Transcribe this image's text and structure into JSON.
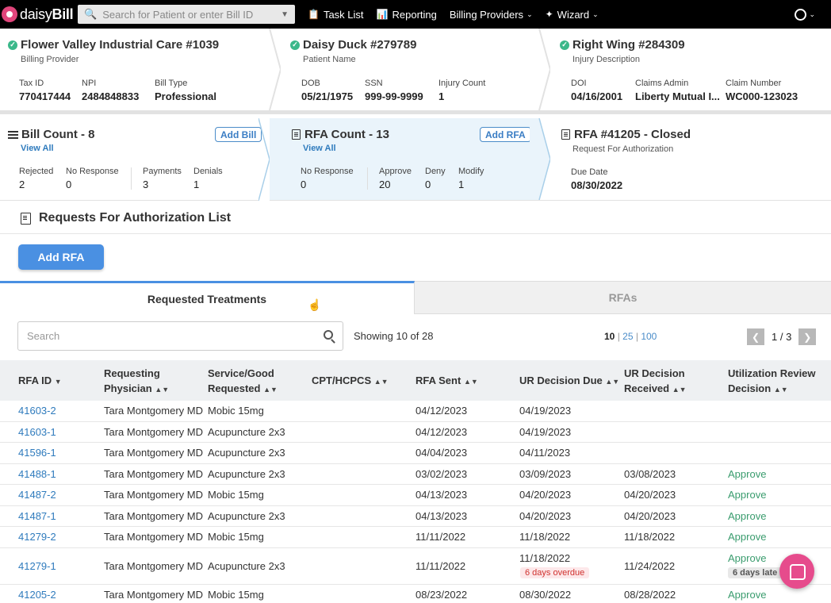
{
  "nav": {
    "logo_plain": "daisy",
    "logo_bold": "Bill",
    "search_placeholder": "Search for Patient or enter Bill ID",
    "task_list": "Task List",
    "reporting": "Reporting",
    "billing_providers": "Billing Providers",
    "wizard": "Wizard"
  },
  "provider": {
    "title": "Flower Valley Industrial Care #1039",
    "subtitle": "Billing Provider",
    "fields": [
      {
        "label": "Tax ID",
        "value": "770417444"
      },
      {
        "label": "NPI",
        "value": "2484848833"
      },
      {
        "label": "Bill Type",
        "value": "Professional"
      }
    ]
  },
  "patient": {
    "title": "Daisy Duck #279789",
    "subtitle": "Patient Name",
    "fields": [
      {
        "label": "DOB",
        "value": "05/21/1975"
      },
      {
        "label": "SSN",
        "value": "999-99-9999"
      },
      {
        "label": "Injury Count",
        "value": "1"
      }
    ]
  },
  "injury": {
    "title": "Right Wing #284309",
    "subtitle": "Injury Description",
    "fields": [
      {
        "label": "DOI",
        "value": "04/16/2001"
      },
      {
        "label": "Claims Admin",
        "value": "Liberty Mutual I..."
      },
      {
        "label": "Claim Number",
        "value": "WC000-123023"
      }
    ]
  },
  "bills": {
    "title": "Bill Count - 8",
    "view_all": "View All",
    "add_label": "Add Bill",
    "fields": [
      {
        "label": "Rejected",
        "value": "2"
      },
      {
        "label": "No Response",
        "value": "0"
      },
      {
        "label": "Payments",
        "value": "3"
      },
      {
        "label": "Denials",
        "value": "1"
      }
    ]
  },
  "rfa_count": {
    "title": "RFA Count - 13",
    "view_all": "View All",
    "add_label": "Add RFA",
    "fields": [
      {
        "label": "No Response",
        "value": "0"
      },
      {
        "label": "Approve",
        "value": "20"
      },
      {
        "label": "Deny",
        "value": "0"
      },
      {
        "label": "Modify",
        "value": "1"
      }
    ]
  },
  "rfa_current": {
    "title": "RFA #41205 - Closed",
    "subtitle": "Request For Authorization",
    "fields": [
      {
        "label": "Due Date",
        "value": "08/30/2022"
      }
    ]
  },
  "section": {
    "title": "Requests For Authorization List",
    "add_button": "Add RFA"
  },
  "tabs": [
    {
      "label": "Requested Treatments",
      "active": true
    },
    {
      "label": "RFAs",
      "active": false
    }
  ],
  "search": {
    "placeholder": "Search",
    "showing": "Showing 10 of 28",
    "sizes": [
      "10",
      "25",
      "100"
    ],
    "page": "1 / 3"
  },
  "columns": [
    {
      "line1": "RFA ID",
      "line2": ""
    },
    {
      "line1": "Requesting",
      "line2": "Physician"
    },
    {
      "line1": "Service/Good",
      "line2": "Requested"
    },
    {
      "line1": "CPT/HCPCS",
      "line2": ""
    },
    {
      "line1": "RFA Sent",
      "line2": ""
    },
    {
      "line1": "UR Decision Due",
      "line2": ""
    },
    {
      "line1": "UR Decision",
      "line2": "Received"
    },
    {
      "line1": "Utilization Review",
      "line2": "Decision"
    }
  ],
  "rows": [
    {
      "id": "41603-2",
      "physician": "Tara Montgomery MD",
      "service": "Mobic 15mg",
      "cpt": "",
      "sent": "04/12/2023",
      "due": "04/19/2023",
      "due_badge": "",
      "received": "",
      "decision": "",
      "decision_badge": ""
    },
    {
      "id": "41603-1",
      "physician": "Tara Montgomery MD",
      "service": "Acupuncture 2x3",
      "cpt": "",
      "sent": "04/12/2023",
      "due": "04/19/2023",
      "due_badge": "",
      "received": "",
      "decision": "",
      "decision_badge": ""
    },
    {
      "id": "41596-1",
      "physician": "Tara Montgomery MD",
      "service": "Acupuncture 2x3",
      "cpt": "",
      "sent": "04/04/2023",
      "due": "04/11/2023",
      "due_badge": "",
      "received": "",
      "decision": "",
      "decision_badge": ""
    },
    {
      "id": "41488-1",
      "physician": "Tara Montgomery MD",
      "service": "Acupuncture 2x3",
      "cpt": "",
      "sent": "03/02/2023",
      "due": "03/09/2023",
      "due_badge": "",
      "received": "03/08/2023",
      "decision": "Approve",
      "decision_badge": ""
    },
    {
      "id": "41487-2",
      "physician": "Tara Montgomery MD",
      "service": "Mobic 15mg",
      "cpt": "",
      "sent": "04/13/2023",
      "due": "04/20/2023",
      "due_badge": "",
      "received": "04/20/2023",
      "decision": "Approve",
      "decision_badge": ""
    },
    {
      "id": "41487-1",
      "physician": "Tara Montgomery MD",
      "service": "Acupuncture 2x3",
      "cpt": "",
      "sent": "04/13/2023",
      "due": "04/20/2023",
      "due_badge": "",
      "received": "04/20/2023",
      "decision": "Approve",
      "decision_badge": ""
    },
    {
      "id": "41279-2",
      "physician": "Tara Montgomery MD",
      "service": "Mobic 15mg",
      "cpt": "",
      "sent": "11/11/2022",
      "due": "11/18/2022",
      "due_badge": "",
      "received": "11/18/2022",
      "decision": "Approve",
      "decision_badge": ""
    },
    {
      "id": "41279-1",
      "physician": "Tara Montgomery MD",
      "service": "Acupuncture 2x3",
      "cpt": "",
      "sent": "11/11/2022",
      "due": "11/18/2022",
      "due_badge": "6 days overdue",
      "received": "11/24/2022",
      "decision": "Approve",
      "decision_badge": "6 days late"
    },
    {
      "id": "41205-2",
      "physician": "Tara Montgomery MD",
      "service": "Mobic 15mg",
      "cpt": "",
      "sent": "08/23/2022",
      "due": "08/30/2022",
      "due_badge": "",
      "received": "08/28/2022",
      "decision": "Approve",
      "decision_badge": ""
    }
  ],
  "colors": {
    "accent": "#4a90e2",
    "link": "#2f7bbd",
    "approve": "#3a9c6e",
    "brand": "#e0457b"
  }
}
